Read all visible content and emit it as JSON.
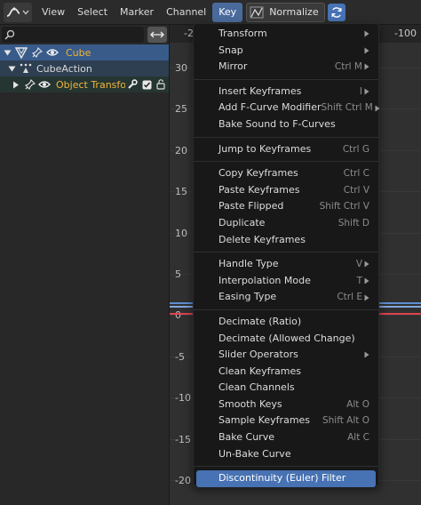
{
  "header": {
    "menus": [
      "View",
      "Select",
      "Marker",
      "Channel",
      "Key"
    ],
    "active_menu": "Key",
    "normalize_label": "Normalize"
  },
  "channels": {
    "rows": [
      {
        "label": "Cube"
      },
      {
        "label": "CubeAction"
      },
      {
        "label": "Object Transforn"
      }
    ]
  },
  "graph": {
    "frame_labels": [
      "-2",
      "-100"
    ],
    "y_labels": [
      "30",
      "25",
      "20",
      "15",
      "10",
      "5",
      "0",
      "-5",
      "-10",
      "-15",
      "-20"
    ]
  },
  "menu": {
    "items": [
      {
        "label": "Transform",
        "submenu": true
      },
      {
        "label": "Snap",
        "submenu": true
      },
      {
        "label": "Mirror",
        "shortcut": "Ctrl M",
        "submenu": true
      },
      {
        "sep": true
      },
      {
        "label": "Insert Keyframes",
        "shortcut": "I",
        "submenu": true
      },
      {
        "label": "Add F-Curve Modifier",
        "shortcut": "Shift Ctrl M",
        "submenu": true
      },
      {
        "label": "Bake Sound to F-Curves"
      },
      {
        "sep": true
      },
      {
        "label": "Jump to Keyframes",
        "shortcut": "Ctrl G"
      },
      {
        "sep": true
      },
      {
        "label": "Copy Keyframes",
        "shortcut": "Ctrl C"
      },
      {
        "label": "Paste Keyframes",
        "shortcut": "Ctrl V"
      },
      {
        "label": "Paste Flipped",
        "shortcut": "Shift Ctrl V"
      },
      {
        "label": "Duplicate",
        "shortcut": "Shift D"
      },
      {
        "label": "Delete Keyframes"
      },
      {
        "sep": true
      },
      {
        "label": "Handle Type",
        "shortcut": "V",
        "submenu": true
      },
      {
        "label": "Interpolation Mode",
        "shortcut": "T",
        "submenu": true
      },
      {
        "label": "Easing Type",
        "shortcut": "Ctrl E",
        "submenu": true
      },
      {
        "sep": true
      },
      {
        "label": "Decimate (Ratio)"
      },
      {
        "label": "Decimate (Allowed Change)"
      },
      {
        "label": "Slider Operators",
        "submenu": true
      },
      {
        "label": "Clean Keyframes"
      },
      {
        "label": "Clean Channels"
      },
      {
        "label": "Smooth Keys",
        "shortcut": "Alt O"
      },
      {
        "label": "Sample Keyframes",
        "shortcut": "Shift Alt O"
      },
      {
        "label": "Bake Curve",
        "shortcut": "Alt C"
      },
      {
        "label": "Un-Bake Curve"
      },
      {
        "sep": true
      },
      {
        "label": "Discontinuity (Euler) Filter",
        "highlighted": true
      }
    ]
  },
  "colors": {
    "accent": "#4772b3",
    "selected_object": "#385b8a",
    "fcurve_red": "#e0424f",
    "fcurve_blue": "#5e8fd1",
    "group_name": "#f0b53b"
  }
}
